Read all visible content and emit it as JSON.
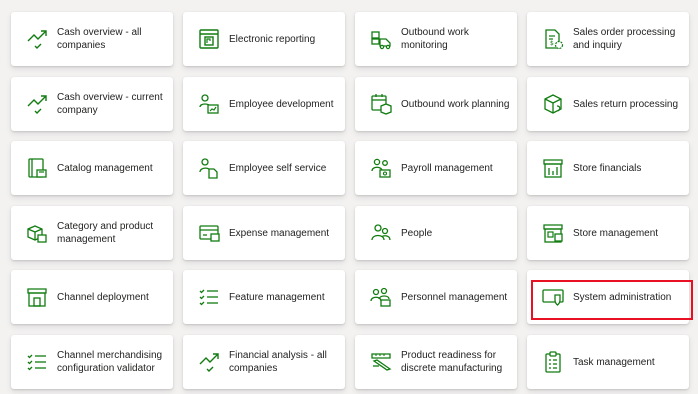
{
  "tiles": [
    {
      "label": "Cash overview - all companies",
      "icon": "trend-up-check-icon"
    },
    {
      "label": "Electronic reporting",
      "icon": "report-document-icon"
    },
    {
      "label": "Outbound work monitoring",
      "icon": "truck-boxes-icon"
    },
    {
      "label": "Sales order processing and inquiry",
      "icon": "order-document-icon"
    },
    {
      "label": "Cash overview - current company",
      "icon": "trend-up-check-icon"
    },
    {
      "label": "Employee development",
      "icon": "person-chart-icon"
    },
    {
      "label": "Outbound work planning",
      "icon": "calendar-box-icon"
    },
    {
      "label": "Sales return processing",
      "icon": "return-box-icon"
    },
    {
      "label": "Catalog management",
      "icon": "catalog-icon"
    },
    {
      "label": "Employee self service",
      "icon": "person-document-icon"
    },
    {
      "label": "Payroll management",
      "icon": "people-money-icon"
    },
    {
      "label": "Store financials",
      "icon": "store-chart-icon"
    },
    {
      "label": "Category and product management",
      "icon": "product-boxes-icon"
    },
    {
      "label": "Expense management",
      "icon": "credit-card-icon"
    },
    {
      "label": "People",
      "icon": "people-icon"
    },
    {
      "label": "Store management",
      "icon": "store-icon"
    },
    {
      "label": "Channel deployment",
      "icon": "store-front-icon"
    },
    {
      "label": "Feature management",
      "icon": "checklist-icon"
    },
    {
      "label": "Personnel management",
      "icon": "people-group-icon"
    },
    {
      "label": "System administration",
      "icon": "shield-window-icon"
    },
    {
      "label": "Channel merchandising configuration validator",
      "icon": "checklist-icon"
    },
    {
      "label": "Financial analysis - all companies",
      "icon": "trend-up-check-icon"
    },
    {
      "label": "Product readiness for discrete manufacturing",
      "icon": "product-ruler-icon"
    },
    {
      "label": "Task management",
      "icon": "clipboard-list-icon"
    }
  ],
  "accent_color": "#107c10",
  "highlight_color": "#e81123",
  "highlighted_tile": "System administration"
}
